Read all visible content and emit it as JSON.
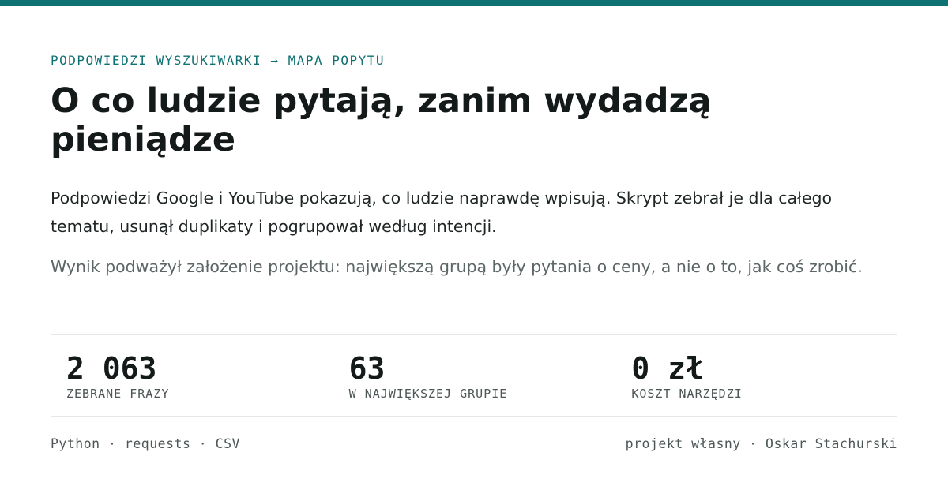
{
  "colors": {
    "accent": "#0e7172",
    "text": "#141a1a",
    "muted": "#5d6666",
    "divider": "#e4e8e8"
  },
  "kicker": "PODPOWIEDZI WYSZUKIWARKI → MAPA POPYTU",
  "headline": "O co ludzie pytają, zanim wydadzą pieniądze",
  "lead": "Podpowiedzi Google i YouTube pokazują, co ludzie naprawdę wpisują. Skrypt zebrał je dla całego tematu, usunął duplikaty i pogrupował według intencji.",
  "note": "Wynik podważył założenie projektu: największą grupą były pytania o ceny, a nie o to, jak coś zrobić.",
  "stats": [
    {
      "value": "2 063",
      "label": "ZEBRANE FRAZY"
    },
    {
      "value": "63",
      "label": "W NAJWIĘKSZEJ GRUPIE"
    },
    {
      "value": "0 zł",
      "label": "KOSZT NARZĘDZI"
    }
  ],
  "footer": {
    "stack": "Python · requests · CSV",
    "credit": "projekt własny · Oskar Stachurski"
  }
}
